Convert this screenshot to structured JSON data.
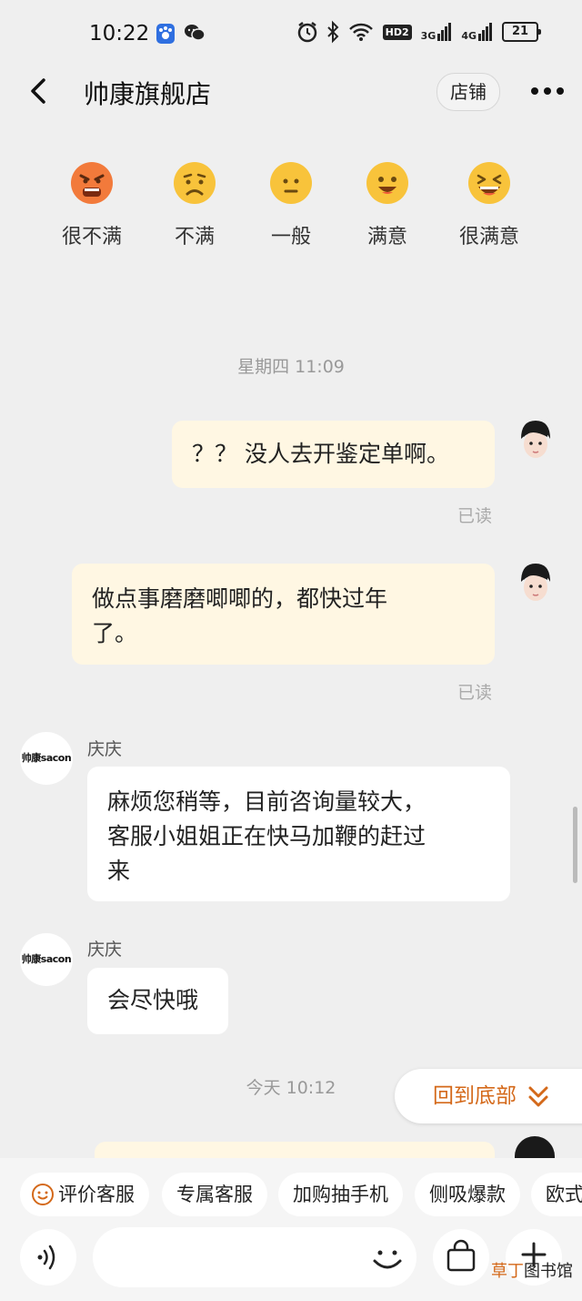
{
  "status_bar": {
    "time": "10:22",
    "hd_label": "HD2",
    "net1": "3G",
    "net2": "4G",
    "battery": "21"
  },
  "header": {
    "title": "帅康旗舰店",
    "store_button": "店铺"
  },
  "rating": [
    {
      "label": "很不满",
      "color": "#f27a3b",
      "icon": "angry-face-icon"
    },
    {
      "label": "不满",
      "color": "#f8c33b",
      "icon": "frown-face-icon"
    },
    {
      "label": "一般",
      "color": "#f8c33b",
      "icon": "neutral-face-icon"
    },
    {
      "label": "满意",
      "color": "#f8c33b",
      "icon": "smile-face-icon"
    },
    {
      "label": "很满意",
      "color": "#f8c33b",
      "icon": "laugh-face-icon"
    }
  ],
  "messages": {
    "time1": "星期四 11:09",
    "m1": "？？ 没人去开鉴定单啊。",
    "m1_read": "已读",
    "m2_line1": "做点事磨磨唧唧的，都快过年",
    "m2_line2": "了。",
    "m2_read": "已读",
    "shop_logo_text": "帅康sacon",
    "sender": "庆庆",
    "m3_line1": "麻烦您稍等，目前咨询量较大，",
    "m3_line2": "客服小姐姐正在快马加鞭的赶过",
    "m3_line3": "来",
    "m4": "会尽快哦",
    "time2": "今天  10:12"
  },
  "back_to_bottom": "回到底部",
  "quick_replies": [
    "评价客服",
    "专属客服",
    "加购抽手机",
    "侧吸爆款",
    "欧式"
  ],
  "watermark": {
    "part1": "草丁",
    "part2": "图书馆"
  },
  "colors": {
    "accent": "#d4691a",
    "bubble_out": "#fff7e3",
    "background": "#efefef"
  }
}
